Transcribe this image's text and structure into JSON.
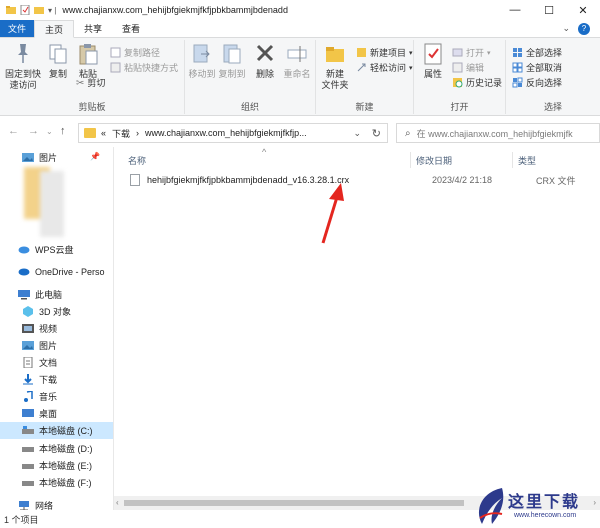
{
  "window": {
    "title": "www.chajianxw.com_hehijbfgiekmjfkfjpbkbammjbdenadd",
    "controls": [
      "—",
      "☐",
      "✕"
    ]
  },
  "ribbon_tabs": {
    "file": "文件",
    "home": "主页",
    "share": "共享",
    "view": "查看"
  },
  "ribbon": {
    "clipboard": {
      "pin_quick_access": "固定到快速访问",
      "copy": "复制",
      "paste": "粘贴",
      "copy_path": "复制路径",
      "paste_shortcut": "粘贴快捷方式",
      "cut": "剪切",
      "group_label": "剪贴板"
    },
    "organize": {
      "move_to": "移动到",
      "copy_to": "复制到",
      "delete": "删除",
      "rename": "重命名",
      "group_label": "组织"
    },
    "new": {
      "new_folder": "新建\n文件夹",
      "new_item": "新建项目",
      "easy_access": "轻松访问",
      "group_label": "新建"
    },
    "open": {
      "properties": "属性",
      "open": "打开",
      "edit": "编辑",
      "history": "历史记录",
      "group_label": "打开"
    },
    "select": {
      "select_all": "全部选择",
      "select_none": "全部取消",
      "invert": "反向选择",
      "group_label": "选择"
    }
  },
  "address": {
    "prefix": "«",
    "crumbs": [
      "下载",
      "www.chajianxw.com_hehijbfgiekmjfkfjp..."
    ],
    "search_placeholder": "在 www.chajianxw.com_hehijbfgiekmjfk"
  },
  "nav_pane": {
    "quick_access_pictures": "图片",
    "wps": "WPS云盘",
    "onedrive": "OneDrive - Perso",
    "this_pc": "此电脑",
    "items": [
      "3D 对象",
      "视频",
      "图片",
      "文档",
      "下载",
      "音乐",
      "桌面"
    ],
    "drives": [
      "本地磁盘 (C:)",
      "本地磁盘 (D:)",
      "本地磁盘 (E:)",
      "本地磁盘 (F:)"
    ],
    "network": "网络"
  },
  "file_list": {
    "columns": [
      "名称",
      "修改日期",
      "类型"
    ],
    "rows": [
      {
        "name": "hehijbfgiekmjfkfjpbkbammjbdenadd_v16.3.28.1.crx",
        "date": "2023/4/2 21:18",
        "type": "CRX 文件"
      }
    ]
  },
  "status": {
    "count": "1 个项目"
  },
  "watermark": {
    "text": "这里下载",
    "url": "www.herecown.com"
  },
  "colors": {
    "accent": "#1a6dc7",
    "folder": "#f2c548",
    "selection": "#cce8ff",
    "annotation_arrow": "#e4261f"
  }
}
